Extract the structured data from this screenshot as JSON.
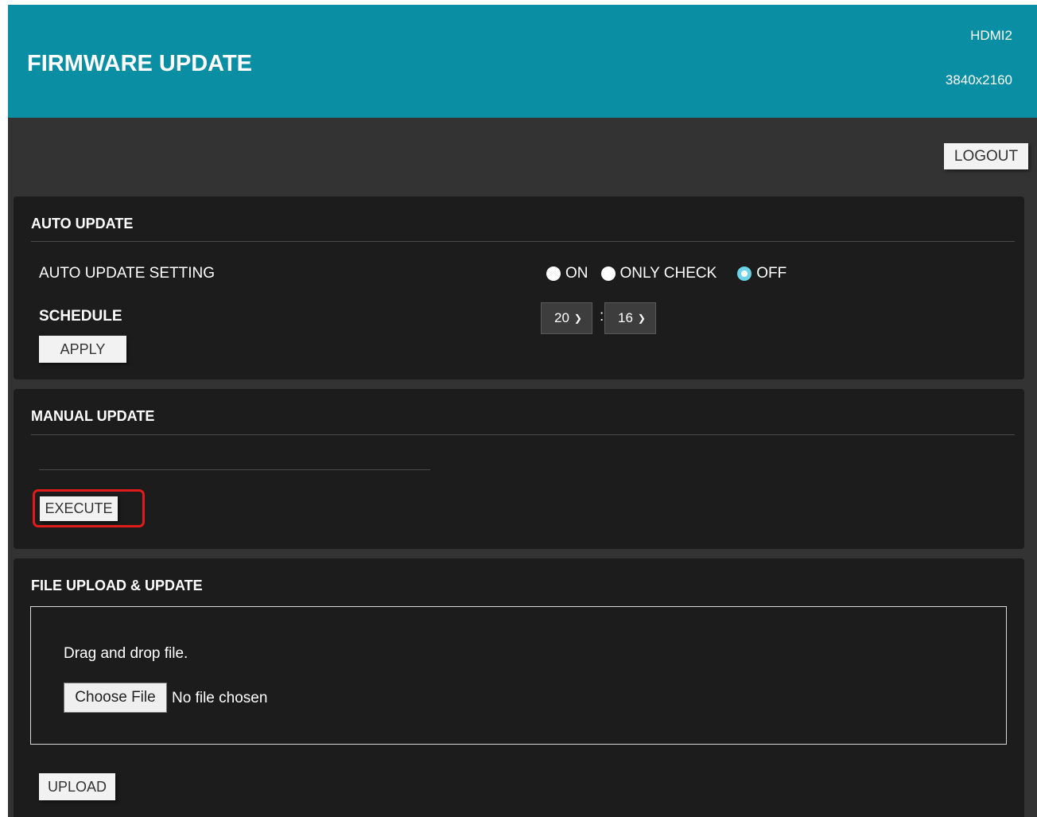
{
  "header": {
    "title": "FIRMWARE UPDATE",
    "input_name": "HDMI2",
    "resolution": "3840x2160"
  },
  "logout_label": "LOGOUT",
  "auto_update": {
    "title": "AUTO UPDATE",
    "setting_label": "AUTO UPDATE SETTING",
    "options": [
      "ON",
      "ONLY CHECK",
      "OFF"
    ],
    "selected_option": "OFF",
    "schedule_label": "SCHEDULE",
    "schedule_hour": "20",
    "schedule_separator": ":",
    "schedule_minute": "16",
    "apply_label": "APPLY"
  },
  "manual_update": {
    "title": "MANUAL UPDATE",
    "execute_label": "EXECUTE",
    "highlight_color": "#e01b1b"
  },
  "file_upload": {
    "title": "FILE UPLOAD & UPDATE",
    "drop_hint": "Drag and drop file.",
    "choose_label": "Choose File",
    "file_status": "No file chosen",
    "upload_label": "UPLOAD"
  },
  "colors": {
    "header_bg": "#0a8ea3",
    "page_bg": "#333333",
    "panel_bg": "#1c1c1c",
    "radio_selected": "#6bd3e8"
  }
}
